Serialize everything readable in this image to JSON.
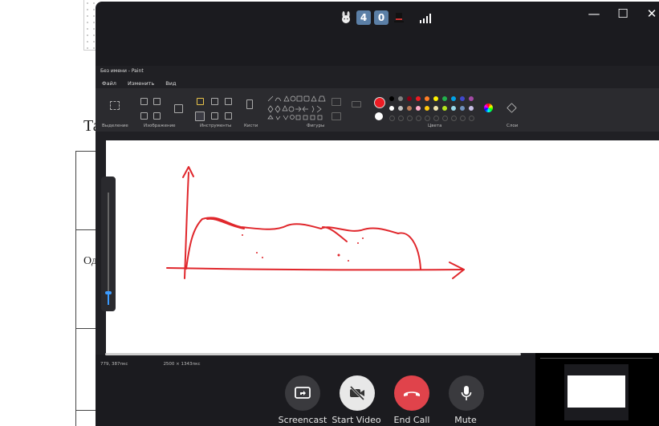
{
  "document": {
    "heading_fragment": "Та",
    "cell_fragment": "Од"
  },
  "top_bar": {
    "badges": [
      "4",
      "0"
    ],
    "window_buttons": [
      "—",
      "☐",
      "✕"
    ]
  },
  "paint": {
    "title": "Без имени - Paint",
    "menu": [
      "Файл",
      "Изменить",
      "Вид"
    ],
    "groups": [
      "Выделение",
      "Изображение",
      "Инструменты",
      "Кисти",
      "Фигуры",
      "Цвета",
      "Слои"
    ],
    "status": [
      "779, 387пкс",
      "2500 × 1343пкс"
    ],
    "colors": {
      "row1": [
        "#000000",
        "#7f7f7f",
        "#880015",
        "#ed1c24",
        "#ff7f27",
        "#fff200",
        "#22b14c",
        "#00a2e8",
        "#3f48cc",
        "#a349a4"
      ],
      "row2": [
        "#ffffff",
        "#c3c3c3",
        "#b97a57",
        "#ffaec9",
        "#ffc90e",
        "#efe4b0",
        "#b5e61d",
        "#99d9ea",
        "#7092be",
        "#c8bfe7"
      ],
      "primary": "#ed1c24",
      "secondary": "#ffffff"
    },
    "drawing_color": "#e0262b"
  },
  "controls": [
    {
      "label": "Screencast",
      "icon": "screencast-icon",
      "color": "#3a3a3e"
    },
    {
      "label": "Start Video",
      "icon": "video-off-icon",
      "color": "#e8e8e8"
    },
    {
      "label": "End Call",
      "icon": "phone-hangup-icon",
      "color": "#e0434b"
    },
    {
      "label": "Mute",
      "icon": "microphone-icon",
      "color": "#3a3a3e"
    }
  ]
}
